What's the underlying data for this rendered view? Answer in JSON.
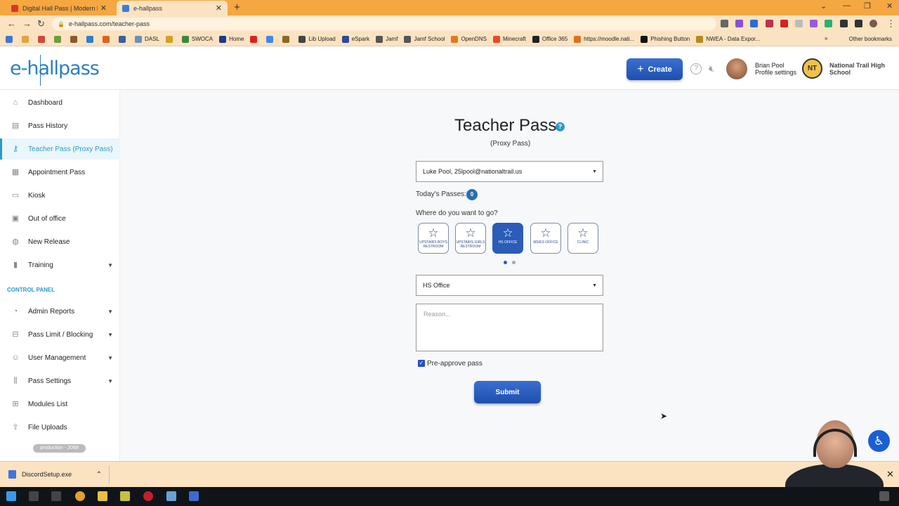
{
  "browser": {
    "tabs": [
      {
        "title": "Digital Hall Pass | Modern Hallwa",
        "fav_color": "#d9362c"
      },
      {
        "title": "e-hallpass",
        "fav_color": "#3b7fd0"
      }
    ],
    "new_tab": "+",
    "url": "e-hallpass.com/teacher-pass",
    "bookmarks": [
      {
        "label": "",
        "color": "#3b78d8"
      },
      {
        "label": "",
        "color": "#e8a23a"
      },
      {
        "label": "",
        "color": "#d44638"
      },
      {
        "label": "",
        "color": "#6a9e3f"
      },
      {
        "label": "",
        "color": "#8a5a2b"
      },
      {
        "label": "",
        "color": "#2b7fd0"
      },
      {
        "label": "",
        "color": "#e06020"
      },
      {
        "label": "",
        "color": "#3a5fa0"
      },
      {
        "label": "DASL",
        "color": "#6c8ebf"
      },
      {
        "label": "",
        "color": "#d6a020"
      },
      {
        "label": "SWOCA",
        "color": "#3a8a3a"
      },
      {
        "label": "Home",
        "color": "#1a3a8a"
      },
      {
        "label": "",
        "color": "#e02020"
      },
      {
        "label": "",
        "color": "#4285f4"
      },
      {
        "label": "",
        "color": "#8a6a20"
      },
      {
        "label": "Lib Upload",
        "color": "#444444"
      },
      {
        "label": "eSpark",
        "color": "#2a4a9a"
      },
      {
        "label": "Jamf",
        "color": "#555555"
      },
      {
        "label": "Jamf School",
        "color": "#555555"
      },
      {
        "label": "OpenDNS",
        "color": "#e07a20"
      },
      {
        "label": "Minecraft",
        "color": "#e84a2a"
      },
      {
        "label": "Office 365",
        "color": "#222222"
      },
      {
        "label": "https://moodle.nati...",
        "color": "#e07020"
      },
      {
        "label": "Phishing Button",
        "color": "#111111"
      },
      {
        "label": "NWEA - Data Expor...",
        "color": "#b88a1a"
      }
    ],
    "other_bookmarks": "Other bookmarks",
    "download_file": "DiscordSetup.exe"
  },
  "header": {
    "logo": "e-hallpass",
    "create_label": "Create",
    "user_name": "Brian Pool",
    "profile_settings": "Profile settings",
    "school_initials": "NT",
    "school_name": "National Trail High School"
  },
  "sidebar": {
    "items": [
      {
        "label": "Dashboard",
        "icon": "home-icon",
        "glyph": "⌂"
      },
      {
        "label": "Pass History",
        "icon": "history-icon",
        "glyph": "▤"
      },
      {
        "label": "Teacher Pass (Proxy Pass)",
        "icon": "key-icon",
        "glyph": "⚷"
      },
      {
        "label": "Appointment Pass",
        "icon": "calendar-icon",
        "glyph": "▦"
      },
      {
        "label": "Kiosk",
        "icon": "kiosk-icon",
        "glyph": "▭"
      },
      {
        "label": "Out of office",
        "icon": "briefcase-icon",
        "glyph": "▣"
      },
      {
        "label": "New Release",
        "icon": "globe-icon",
        "glyph": "◍"
      },
      {
        "label": "Training",
        "icon": "training-icon",
        "glyph": "▮"
      }
    ],
    "control_panel_title": "CONTROL PANEL",
    "cp_items": [
      {
        "label": "Admin Reports",
        "icon": "chart-icon",
        "glyph": "◔"
      },
      {
        "label": "Pass Limit / Blocking",
        "icon": "limit-icon",
        "glyph": "⊟"
      },
      {
        "label": "User Management",
        "icon": "users-icon",
        "glyph": "☺"
      },
      {
        "label": "Pass Settings",
        "icon": "settings-icon",
        "glyph": "⫼"
      },
      {
        "label": "Modules List",
        "icon": "grid-icon",
        "glyph": "⊞"
      },
      {
        "label": "File Uploads",
        "icon": "upload-icon",
        "glyph": "⇪"
      }
    ],
    "version": "production - 2069"
  },
  "main": {
    "title": "Teacher Pass",
    "subtitle": "(Proxy Pass)",
    "student_select": "Luke Pool, 25lpool@nationaltrail.us",
    "todays_passes_label": "Today's Passes:",
    "todays_passes_count": "0",
    "where_label": "Where do you want to go?",
    "destinations": [
      {
        "label": "UPSTAIRS BOYS RESTROOM",
        "selected": false
      },
      {
        "label": "UPSTAIRS GIRLS RESTROOM",
        "selected": false
      },
      {
        "label": "HS OFFICE",
        "selected": true
      },
      {
        "label": "MS/ES OFFICE",
        "selected": false
      },
      {
        "label": "CLINIC",
        "selected": false
      }
    ],
    "destination_select": "HS Office",
    "reason_placeholder": "Reason...",
    "preapprove_label": "Pre-approve pass",
    "preapprove_checked": true,
    "submit_label": "Submit"
  },
  "colors": {
    "accent": "#2b9ac8",
    "primary_button": "#2a5cb8",
    "browser_frame": "#f5a742"
  }
}
